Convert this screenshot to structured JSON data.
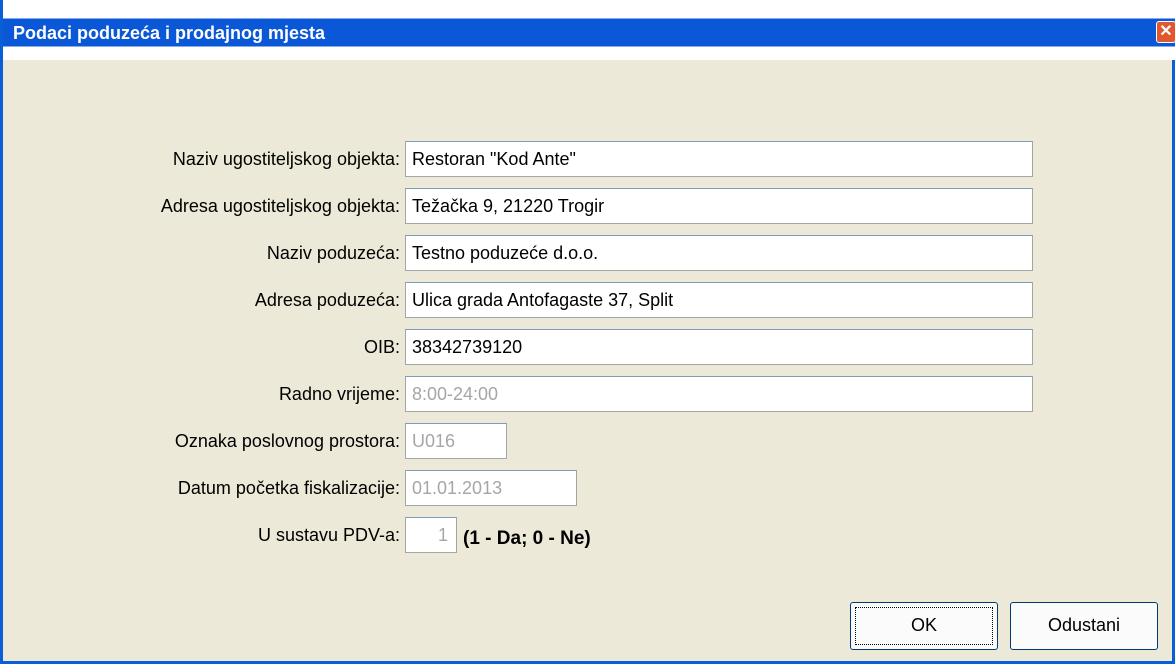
{
  "window": {
    "title": "Podaci poduzeća i prodajnog mjesta",
    "close_glyph": "✕"
  },
  "fields": [
    {
      "label": "Naziv ugostiteljskog objekta:",
      "value": "Restoran \"Kod Ante\""
    },
    {
      "label": "Adresa ugostiteljskog objekta:",
      "value": "Težačka 9, 21220 Trogir"
    },
    {
      "label": "Naziv poduzeća:",
      "value": "Testno poduzeće d.o.o."
    },
    {
      "label": "Adresa poduzeća:",
      "value": "Ulica grada Antofagaste 37, Split"
    },
    {
      "label": "OIB:",
      "value": "38342739120"
    },
    {
      "label": "Radno vrijeme:",
      "value": "8:00-24:00"
    },
    {
      "label": "Oznaka poslovnog prostora:",
      "value": "U016"
    },
    {
      "label": "Datum početka fiskalizacije:",
      "value": "01.01.2013"
    },
    {
      "label": "U sustavu PDV-a:",
      "value": "1"
    }
  ],
  "pdv_hint": "(1 - Da; 0 - Ne)",
  "buttons": {
    "ok": "OK",
    "cancel": "Odustani"
  }
}
